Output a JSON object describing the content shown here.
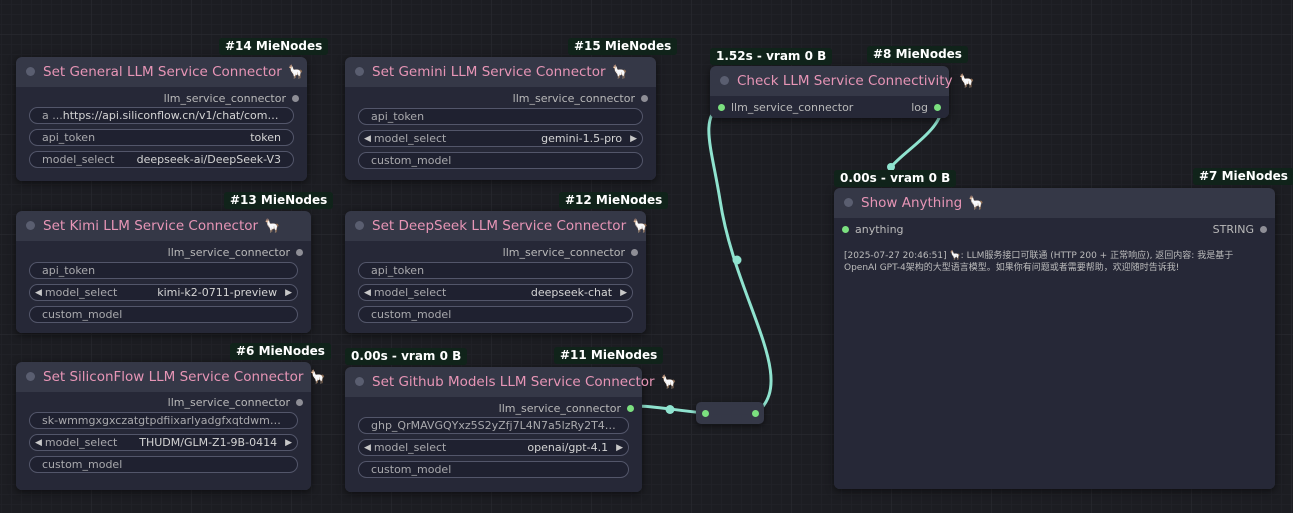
{
  "nodes": {
    "general": {
      "badge": "#14 MieNodes",
      "title": "Set General LLM Service Connector",
      "emoji": "🦙",
      "output": "llm_service_connector",
      "w1_label": "a ...",
      "w1_value": "https://api.siliconflow.cn/v1/chat/completions",
      "w2_label": "api_token",
      "w2_value": "token",
      "w3_label": "model_select",
      "w3_value": "deepseek-ai/DeepSeek-V3"
    },
    "gemini": {
      "badge": "#15 MieNodes",
      "title": "Set Gemini LLM Service Connector",
      "emoji": "🦙",
      "output": "llm_service_connector",
      "w1_label": "api_token",
      "w2_label": "model_select",
      "w2_value": "gemini-1.5-pro",
      "w3_label": "custom_model"
    },
    "kimi": {
      "badge": "#13 MieNodes",
      "title": "Set Kimi LLM Service Connector",
      "emoji": "🦙",
      "output": "llm_service_connector",
      "w1_label": "api_token",
      "w2_label": "model_select",
      "w2_value": "kimi-k2-0711-preview",
      "w3_label": "custom_model"
    },
    "deepseek": {
      "badge": "#12 MieNodes",
      "title": "Set DeepSeek LLM Service Connector",
      "emoji": "🦙",
      "output": "llm_service_connector",
      "w1_label": "api_token",
      "w2_label": "model_select",
      "w2_value": "deepseek-chat",
      "w3_label": "custom_model"
    },
    "siliconflow": {
      "badge": "#6 MieNodes",
      "title": "Set SiliconFlow LLM Service Connector",
      "emoji": "🦙",
      "output": "llm_service_connector",
      "w1_value": "sk-wmmgxgxczatgtpdfiixarlyadgfxqtdwmecwqnd...",
      "w2_label": "model_select",
      "w2_value": "THUDM/GLM-Z1-9B-0414",
      "w3_label": "custom_model"
    },
    "github": {
      "badge": "#11 MieNodes",
      "timing": "0.00s - vram 0 B",
      "title": "Set Github Models LLM Service Connector",
      "emoji": "🦙",
      "output": "llm_service_connector",
      "w1_value": "ghp_QrMAVGQYxz5S2yZfj7L4N7a5lzRy2T4aA ...",
      "w2_label": "model_select",
      "w2_value": "openai/gpt-4.1",
      "w3_label": "custom_model"
    },
    "check": {
      "badge": "#8 MieNodes",
      "timing": "1.52s - vram 0 B",
      "title": "Check LLM Service Connectivity",
      "emoji": "🦙",
      "input": "llm_service_connector",
      "output": "log"
    },
    "show": {
      "badge": "#7 MieNodes",
      "timing": "0.00s - vram 0 B",
      "title": "Show Anything",
      "emoji": "🦙",
      "input": "anything",
      "output": "STRING",
      "text": "[2025-07-27 20:46:51] 🦙: LLM服务接口可联通 (HTTP 200 + 正常响应), 返回内容: 我是基于OpenAI GPT-4架构的大型语言模型。如果你有问题或者需要帮助，欢迎随时告诉我!"
    }
  },
  "colors": {
    "title_text": "#e795b6",
    "wire": "#8fe3cf",
    "socket_connected": "#7be07f",
    "badge_bg": "#10231a"
  },
  "icons": {
    "left_arrow": "◀",
    "right_arrow": "▶"
  }
}
